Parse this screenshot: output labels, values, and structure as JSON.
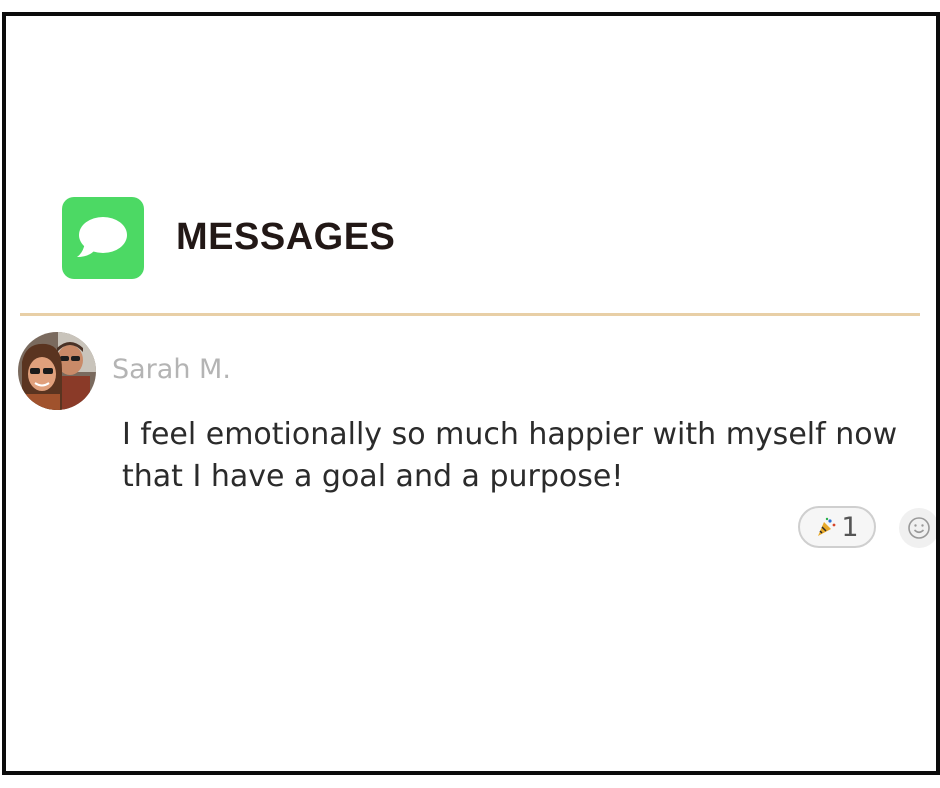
{
  "header": {
    "app_icon": "messages-bubble-icon",
    "title": "MESSAGES"
  },
  "message": {
    "author": "Sarah M.",
    "text": "I feel emotionally so much happier with myself now that I have a goal and a purpose!",
    "reaction": {
      "icon": "party-popper-icon",
      "count": "1"
    },
    "add_reaction_icon": "smiley-icon"
  },
  "colors": {
    "app_icon": "#4cd964",
    "divider": "#e8cfa6",
    "author": "#b4b4b4",
    "text": "#2b2b2b",
    "frame": "#0b0b0b"
  }
}
